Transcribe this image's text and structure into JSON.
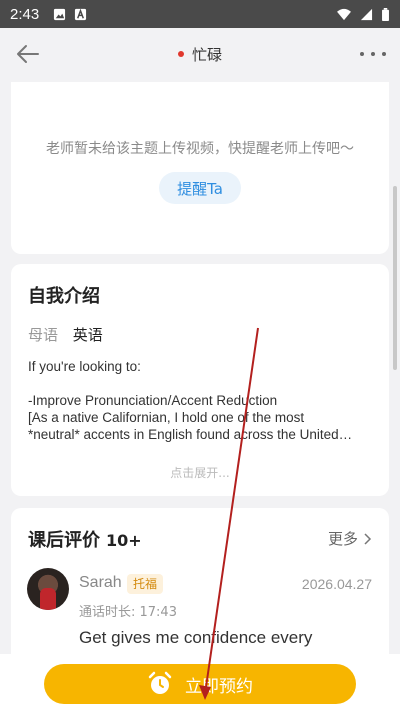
{
  "status_bar": {
    "time": "2:43",
    "icons": [
      "image-icon",
      "a-icon",
      "wifi-icon",
      "signal-icon",
      "battery-icon"
    ]
  },
  "header": {
    "status_text": "忙碌",
    "status_color": "#e0372d",
    "back_icon": "arrow-left-icon",
    "more_icon": "more-horizontal-icon"
  },
  "video_card": {
    "message": "老师暂未给该主题上传视频，快提醒老师上传吧～",
    "remind_button": "提醒Ta"
  },
  "intro": {
    "title": "自我介绍",
    "native_label": "母语",
    "native_value": "英语",
    "lines": [
      "If you're looking to:",
      "",
      "-Improve Pronunciation/Accent Reduction",
      "[As a native Californian, I hold one of the most",
      "*neutral* accents in English found across the United…"
    ],
    "expand": "点击展开..."
  },
  "reviews": {
    "title": "课后评价",
    "count": "10+",
    "more": "更多",
    "items": [
      {
        "name": "Sarah",
        "tag": "托福",
        "date": "2026.04.27",
        "duration": "通话时长: 17:43",
        "text": "Get gives me confidence every"
      }
    ]
  },
  "bottom": {
    "book_button": "立即预约",
    "accent_color": "#f7b500"
  }
}
